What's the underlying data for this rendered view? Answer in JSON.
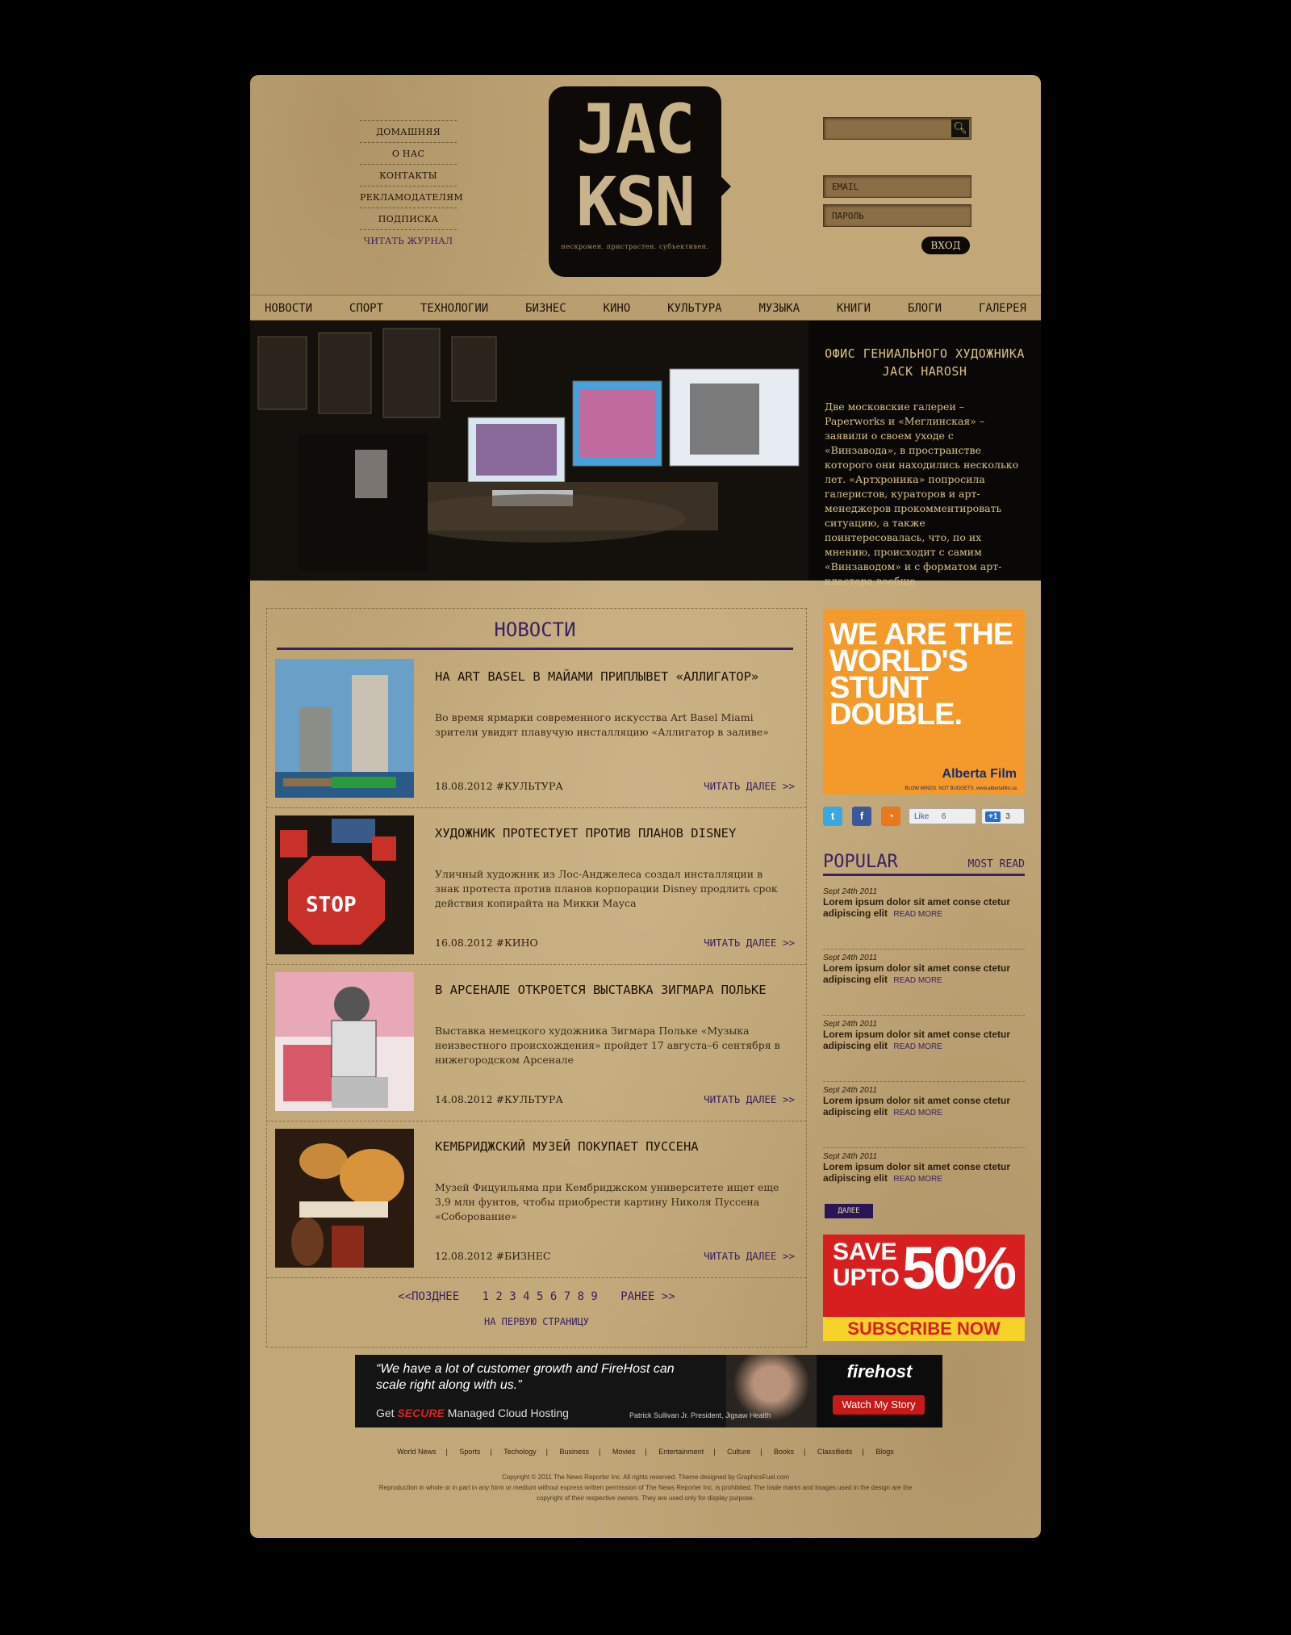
{
  "top_nav": [
    "ДОМАШНЯЯ",
    "О НАС",
    "КОНТАКТЫ",
    "РЕКЛАМОДАТЕЛЯМ",
    "ПОДПИСКА",
    "ЧИТАТЬ ЖУРНАЛ"
  ],
  "logo": {
    "line1": "JAC",
    "line2": "KSN",
    "tagline": "нескромен. пристрастен. субъективен."
  },
  "auth": {
    "email_placeholder": "EMAIL",
    "password_placeholder": "ПАРОЛЬ",
    "login_label": "ВХОД"
  },
  "main_nav": [
    "НОВОСТИ",
    "СПОРТ",
    "ТЕХНОЛОГИИ",
    "БИЗНЕС",
    "КИНО",
    "КУЛЬТУРА",
    "МУЗЫКА",
    "КНИГИ",
    "БЛОГИ",
    "ГАЛЕРЕЯ"
  ],
  "hero": {
    "title": "ОФИС ГЕНИАЛЬНОГО ХУДОЖНИКА JACK HAROSH",
    "body": "Две московские галереи – Paperworks и «Меглинская» – заявили о своем уходе с «Винзавода», в пространстве которого они находились несколько лет. «Артхроника» попросила галеристов, кураторов и арт-менеджеров прокомментировать ситуацию, а также поинтересовалась, что, по их мнению, происходит с самим «Винзаводом» и с форматом арт-кластера вообще"
  },
  "news": {
    "heading": "НОВОСТИ",
    "items": [
      {
        "title": "НА ART BASEL В МАЙАМИ ПРИПЛЫВЕТ «АЛЛИГАТОР»",
        "body": "Во время ярмарки современного искусства Art Basel Miami зрители увидят плавучую инсталляцию «Аллигатор в заливе»",
        "date": "18.08.2012",
        "tag": "#КУЛЬТУРА",
        "more": "ЧИТАТЬ ДАЛЕЕ >>"
      },
      {
        "title": "ХУДОЖНИК ПРОТЕСТУЕТ ПРОТИВ ПЛАНОВ DISNEY",
        "body": "Уличный художник из Лос-Анджелеса создал инсталляции в знак протеста против планов корпорации Disney продлить срок действия копирайта на Микки Мауса",
        "date": "16.08.2012",
        "tag": "#КИНО",
        "more": "ЧИТАТЬ ДАЛЕЕ >>"
      },
      {
        "title": "В АРСЕНАЛЕ ОТКРОЕТСЯ ВЫСТАВКА ЗИГМАРА ПОЛЬКЕ",
        "body": "Выставка немецкого художника Зигмара Польке «Музыка неизвестного происхождения» пройдет 17 августа–6 сентября в нижегородском Арсенале",
        "date": "14.08.2012",
        "tag": "#КУЛЬТУРА",
        "more": "ЧИТАТЬ ДАЛЕЕ >>"
      },
      {
        "title": "КЕМБРИДЖСКИЙ МУЗЕЙ ПОКУПАЕТ ПУССЕНА",
        "body": "Музей Фицуильяма при Кембриджском университете ищет еще 3,9 млн фунтов, чтобы приобрести картину Николя Пуссена «Соборование»",
        "date": "12.08.2012",
        "tag": "#БИЗНЕС",
        "more": "ЧИТАТЬ ДАЛЕЕ >>"
      }
    ],
    "pager": {
      "prev": "<<ПОЗДНЕЕ",
      "pages": "1 2 3 4 5 6 7 8 9",
      "next": "РАНЕЕ >>",
      "first": "НА ПЕРВУЮ СТРАНИЦУ"
    }
  },
  "ad_top": {
    "text": "WE ARE THE WORLD'S STUNT DOUBLE.",
    "brand": "Alberta Film",
    "slogan": "BLOW MINDS. NOT BUDGETS. www.albertafilm.ca"
  },
  "social": {
    "fb_like": "Like",
    "fb_count": "6",
    "gplus": "+1",
    "gplus_count": "3"
  },
  "popular": {
    "title": "POPULAR",
    "tab": "MOST READ",
    "items": [
      {
        "date": "Sept 24th 2011",
        "text": "Lorem ipsum dolor sit amet conse ctetur adipiscing elit",
        "more": "READ MORE"
      },
      {
        "date": "Sept 24th 2011",
        "text": "Lorem ipsum dolor sit amet conse ctetur adipiscing elit",
        "more": "READ MORE"
      },
      {
        "date": "Sept 24th 2011",
        "text": "Lorem ipsum dolor sit amet conse ctetur adipiscing elit",
        "more": "READ MORE"
      },
      {
        "date": "Sept 24th 2011",
        "text": "Lorem ipsum dolor sit amet conse ctetur adipiscing elit",
        "more": "READ MORE"
      },
      {
        "date": "Sept 24th 2011",
        "text": "Lorem ipsum dolor sit amet conse ctetur adipiscing elit",
        "more": "READ MORE"
      }
    ],
    "more_button": "ДАЛЕЕ"
  },
  "ad_bottom": {
    "save": "SAVE UPTO",
    "percent": "50%",
    "cta": "SUBSCRIBE NOW"
  },
  "banner": {
    "quote": "“We have a lot of customer growth and FireHost can scale right along with us.”",
    "get": "Get",
    "secure": "SECURE",
    "rest": "Managed Cloud Hosting",
    "person": "Patrick Sullivan Jr. President, Jigsaw Health",
    "brand": "firehost",
    "cta": "Watch My Story"
  },
  "footer_nav": [
    "World News",
    "Sports",
    "Techology",
    "Business",
    "Movies",
    "Entertainment",
    "Culture",
    "Books",
    "Classifieds",
    "Blogs"
  ],
  "copyright": "Copyright © 2011 The News Reporter Inc. All rights reserved. Theme designed by GraphicsFuel.com",
  "disclaimer": "Reproduction in whole or in part in any form or medium without express written permission of The News Reporter Inc. is prohibited. The trade marks and images used in the design are the copyright of their respective owners. They are used only for display purpose."
}
